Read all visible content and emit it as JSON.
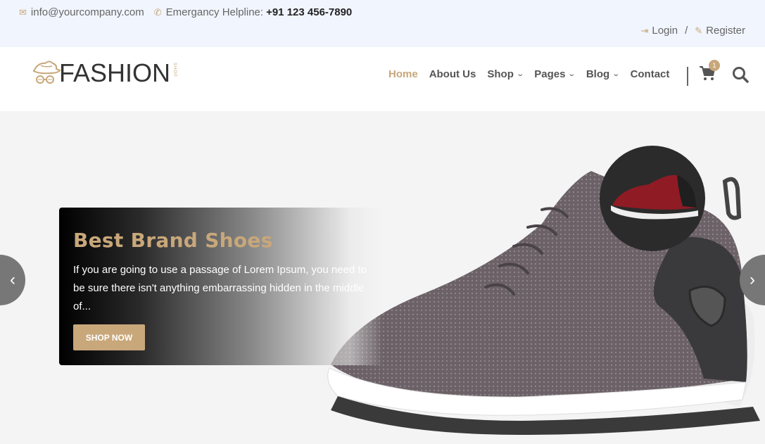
{
  "topbar": {
    "email": "info@yourcompany.com",
    "helpline_label": "Emergancy Helpline:",
    "helpline_number": "+91 123 456-7890",
    "login": "Login",
    "separator": "/",
    "register": "Register"
  },
  "logo": {
    "word": "FASHION",
    "sub": "SHOP"
  },
  "nav": {
    "items": [
      {
        "label": "Home",
        "active": true
      },
      {
        "label": "About Us"
      },
      {
        "label": "Shop",
        "dropdown": true
      },
      {
        "label": "Pages",
        "dropdown": true
      },
      {
        "label": "Blog",
        "dropdown": true
      },
      {
        "label": "Contact"
      }
    ],
    "cart_count": "1"
  },
  "hero": {
    "title": "Best Brand Shoes",
    "text": "If you are going to use a passage of Lorem Ipsum, you need to be sure there isn't anything embarrassing hidden in the middle of...",
    "button": "SHOP NOW",
    "prev": "‹",
    "next": "›"
  },
  "colors": {
    "accent": "#c8a77a",
    "topbar_bg": "#f1f5fd",
    "hero_bg": "#f4f4f4"
  }
}
